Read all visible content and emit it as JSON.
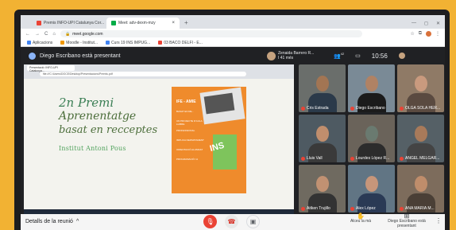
{
  "browser": {
    "tabs": [
      {
        "title": "Premis INFO-UPI Catalunya Cor...",
        "fav_color": "#ea4335",
        "active": false
      },
      {
        "title": "Meet: adv-dexm-mzy",
        "fav_color": "#00ac47",
        "active": true
      }
    ],
    "new_tab": "+",
    "window_controls": [
      "—",
      "◻",
      "✕"
    ],
    "url": "meet.google.com",
    "nav": [
      "←",
      "→",
      "C",
      "⌂"
    ],
    "bookmarks": [
      {
        "label": "Aplicacions",
        "color": "#4285f4"
      },
      {
        "label": "Moodle - Institut...",
        "color": "#f29900"
      },
      {
        "label": "Curs 19 INS IMPUG...",
        "color": "#4285f4"
      },
      {
        "label": "03 BACO DELFI - E...",
        "color": "#ea4335"
      }
    ]
  },
  "meet": {
    "presenting_text": "Diego Escribano està presentant",
    "self": {
      "name": "Zenaida Barrero R...",
      "subtitle": "I 41 més"
    },
    "people_count": "42",
    "time": "10:56",
    "inner_tab": "Presentació: INFO-UPI Catalunya...",
    "inner_url": "file:///C:/Users/DOCE/Desktop/Presentacions/Premis.pdf",
    "slide": {
      "line1": "2n Premi",
      "line2": "Aprenentatge",
      "line3": "basat en recceptes",
      "line4": "Institut Antoni Pous",
      "poster_title": "IFE - AMIE",
      "poster_lines": [
        "BASAT EN RE...",
        "UN PROJECTE D'AULA LLIBRE",
        "PROFESSIONAL",
        "IMPLICA DEPARTAMENT",
        "ORIENTACIÓ ALUMNAT",
        "PROGRAMACIÓ I A"
      ],
      "poster_mark": "INS"
    },
    "participants": [
      {
        "name": "Cris Estrada",
        "bg": "#6a6e6b",
        "skin": "#a27553",
        "shirt": "#2b3a4a"
      },
      {
        "name": "Diego Escribano",
        "bg": "#7a8a96",
        "skin": "#b08264",
        "shirt": "#1b1b1b"
      },
      {
        "name": "OLGA SOLA HER...",
        "bg": "#8f7a66",
        "skin": "#c99a7e",
        "shirt": "#5a4a40"
      },
      {
        "name": "Lluis Vall",
        "bg": "#4e5a62",
        "skin": "#c08e6d",
        "shirt": "#3a3a3a"
      },
      {
        "name": "Lourdes López R...",
        "bg": "#6a635a",
        "skin": "#6a7a70",
        "shirt": "#2c2c2c"
      },
      {
        "name": "ANGEL MELGAR...",
        "bg": "#556066",
        "skin": "#a87a5a",
        "shirt": "#444"
      },
      {
        "name": "Aitken Trujillo",
        "bg": "#6f6a60",
        "skin": "#c19172",
        "shirt": "#333"
      },
      {
        "name": "Alex López",
        "bg": "#617584",
        "skin": "#c7967a",
        "shirt": "#2a3a55"
      },
      {
        "name": "ANA MARIA M...",
        "bg": "#7d6c5c",
        "skin": "#bf8d6b",
        "shirt": "#4a3f36"
      }
    ],
    "bottom": {
      "details_label": "Detalls de la reunió",
      "raise_hand_label": "Alceu la mà",
      "present_label": "Diego Escribano està presentant"
    }
  }
}
